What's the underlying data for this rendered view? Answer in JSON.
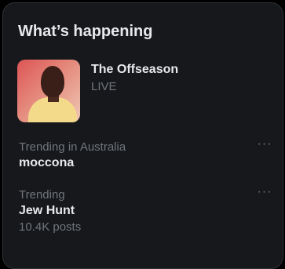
{
  "section": {
    "title": "What’s happening"
  },
  "space": {
    "name": "The Offseason",
    "status": "LIVE"
  },
  "trends": [
    {
      "context": "Trending in Australia",
      "name": "moccona",
      "count": ""
    },
    {
      "context": "Trending",
      "name": "Jew Hunt",
      "count": "10.4K posts"
    }
  ],
  "icons": {
    "more": "more-horizontal-icon"
  },
  "colors": {
    "panel": "#16181c",
    "text": "#e7e9ea",
    "muted": "#71767b"
  }
}
